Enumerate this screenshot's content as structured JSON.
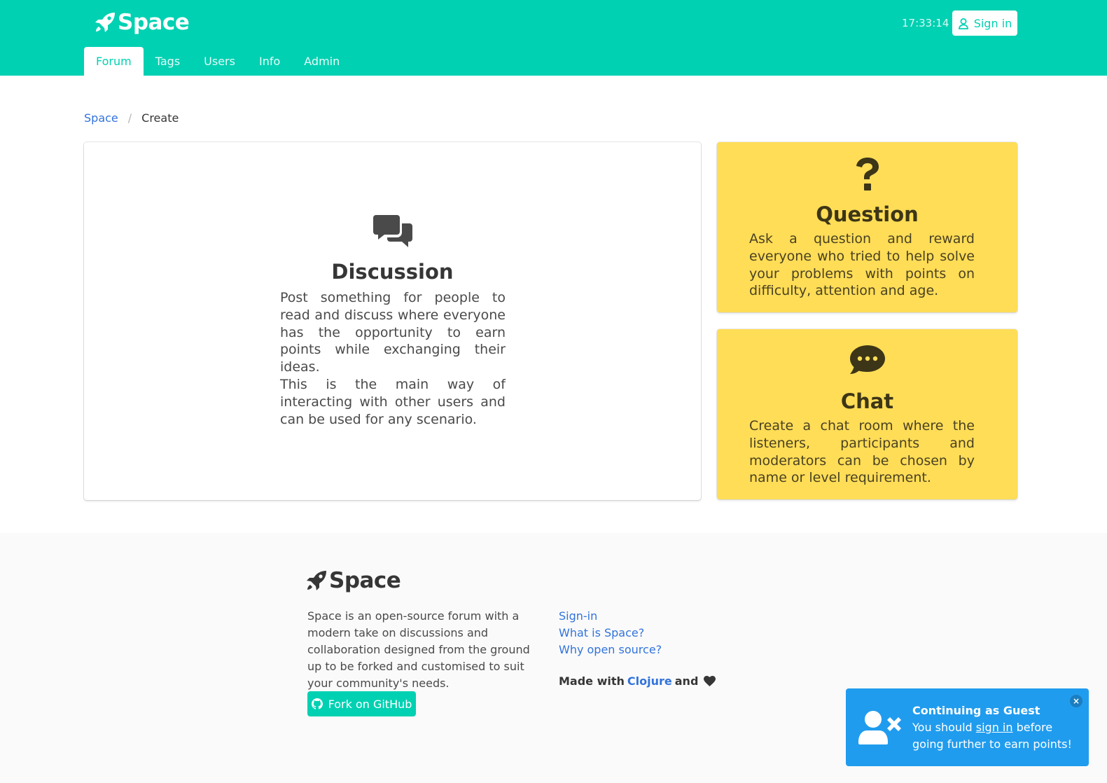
{
  "header": {
    "brand": "Space",
    "clock": "17:33:14",
    "signin_label": "Sign in",
    "tabs": [
      {
        "label": "Forum",
        "active": true
      },
      {
        "label": "Tags"
      },
      {
        "label": "Users"
      },
      {
        "label": "Info"
      },
      {
        "label": "Admin"
      }
    ]
  },
  "breadcrumb": {
    "root": "Space",
    "separator": "/",
    "current": "Create"
  },
  "cards": {
    "discussion": {
      "icon": "comments-icon",
      "title": "Discussion",
      "text1": "Post something for people to read and discuss where everyone has the opportunity to earn points while exchanging their ideas.",
      "text2": "This is the main way of interacting with other users and can be used for any scenario."
    },
    "question": {
      "icon": "question-icon",
      "title": "Question",
      "text": "Ask a question and reward everyone who tried to help solve your problems with points on difficulty, attention and age."
    },
    "chat": {
      "icon": "comment-dots-icon",
      "title": "Chat",
      "text": "Create a chat room where the listeners, participants and moderators can be chosen by name or level requirement."
    }
  },
  "footer": {
    "brand": "Space",
    "about": "Space is an open-source forum with a modern take on discussions and collaboration designed from the ground up to be forked and customised to suit your community's needs.",
    "github_label": "Fork on GitHub",
    "links": [
      "Sign-in",
      "What is Space?",
      "Why open source?"
    ],
    "made_with": "Made with",
    "clojure": "Clojure",
    "and": "and"
  },
  "notification": {
    "title": "Continuing as Guest",
    "body_prefix": "You should",
    "body_link": "sign in",
    "body_suffix": "before going further to earn points!",
    "close": "×"
  },
  "colors": {
    "primary": "#00d1b2",
    "warning": "#ffdd57",
    "info": "#209cee",
    "link": "#3273dc"
  }
}
